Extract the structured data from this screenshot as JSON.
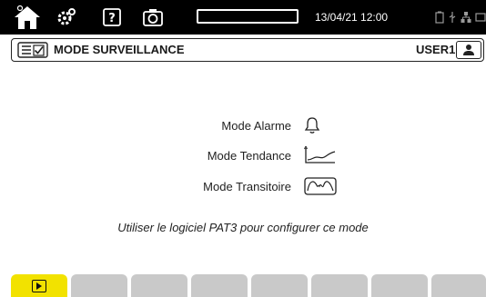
{
  "status_bar": {
    "datetime": "13/04/21 12:00",
    "progress_fraction": 0,
    "icons": [
      "home-icon",
      "settings-icon",
      "help-icon",
      "camera-icon",
      "battery-icon",
      "usb-icon",
      "network-icon",
      "screen-icon"
    ]
  },
  "header": {
    "title": "MODE SURVEILLANCE",
    "user": "USER1"
  },
  "modes": [
    {
      "label": "Mode Alarme",
      "icon": "bell-icon"
    },
    {
      "label": "Mode Tendance",
      "icon": "trend-chart-icon"
    },
    {
      "label": "Mode Transitoire",
      "icon": "transient-wave-icon"
    }
  ],
  "info_text": "Utiliser le logiciel PAT3 pour configurer ce mode",
  "tabs": {
    "count": 8,
    "active_index": 0,
    "active_icon": "play-icon",
    "colors": {
      "active": "#f2e200",
      "inactive": "#c9c9c9"
    }
  }
}
